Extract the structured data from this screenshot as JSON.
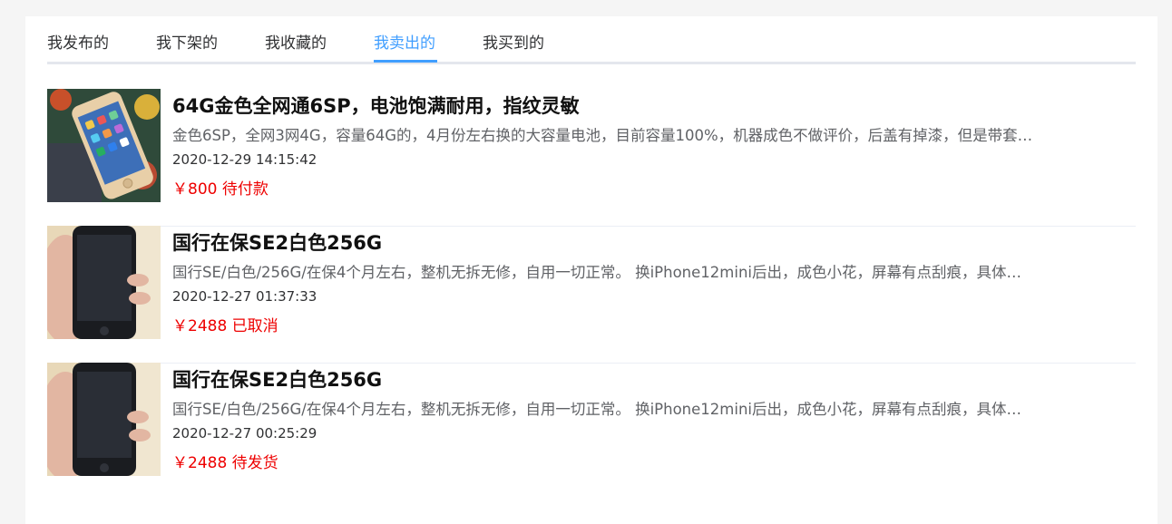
{
  "tabs": [
    {
      "label": "我发布的",
      "active": false
    },
    {
      "label": "我下架的",
      "active": false
    },
    {
      "label": "我收藏的",
      "active": false
    },
    {
      "label": "我卖出的",
      "active": true
    },
    {
      "label": "我买到的",
      "active": false
    }
  ],
  "items": [
    {
      "title": "64G金色全网通6SP，电池饱满耐用，指纹灵敏",
      "desc": "金色6SP，全网3网4G，容量64G的，4月份左右换的大容量电池，目前容量100%，机器成色不做评价，后盖有掉漆，但是带套…",
      "time": "2020-12-29 14:15:42",
      "price": "￥800",
      "status": "待付款"
    },
    {
      "title": "国行在保SE2白色256G",
      "desc": "国行SE/白色/256G/在保4个月左右，整机无拆无修，自用一切正常。 换iPhone12mini后出，成色小花，屏幕有点刮痕，具体…",
      "time": "2020-12-27 01:37:33",
      "price": "￥2488",
      "status": "已取消"
    },
    {
      "title": "国行在保SE2白色256G",
      "desc": "国行SE/白色/256G/在保4个月左右，整机无拆无修，自用一切正常。 换iPhone12mini后出，成色小花，屏幕有点刮痕，具体…",
      "time": "2020-12-27 00:25:29",
      "price": "￥2488",
      "status": "待发货"
    }
  ],
  "colors": {
    "accent": "#409eff",
    "price": "#ee0000"
  }
}
